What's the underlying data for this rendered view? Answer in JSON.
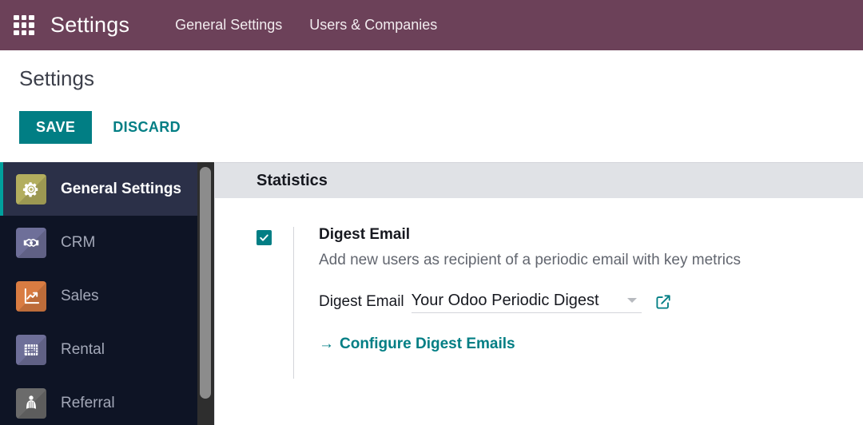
{
  "navbar": {
    "apps_icon": "grid-apps-icon",
    "brand": "Settings",
    "items": [
      {
        "label": "General Settings"
      },
      {
        "label": "Users & Companies"
      }
    ],
    "background_color": "#6c4159"
  },
  "control_panel": {
    "page_title": "Settings",
    "save_label": "SAVE",
    "discard_label": "DISCARD",
    "accent_color": "#017e84"
  },
  "sidebar": {
    "items": [
      {
        "label": "General Settings",
        "icon": "gear-icon",
        "icon_bg": "#b3ae5e",
        "active": true
      },
      {
        "label": "CRM",
        "icon": "handshake-icon",
        "icon_bg": "#6e6f99",
        "active": false
      },
      {
        "label": "Sales",
        "icon": "chart-arrow-icon",
        "icon_bg": "#d97c42",
        "active": false
      },
      {
        "label": "Rental",
        "icon": "calendar-grid-icon",
        "icon_bg": "#6e6f99",
        "active": false
      },
      {
        "label": "Referral",
        "icon": "person-cape-icon",
        "icon_bg": "#6b6b6b",
        "active": false
      }
    ],
    "background_color": "#0e1425",
    "active_background_color": "#2b3048",
    "active_accent_color": "#00a09d"
  },
  "main": {
    "section_title": "Statistics",
    "setting": {
      "checked": true,
      "name": "Digest Email",
      "description": "Add new users as recipient of a periodic email with key metrics",
      "field_label": "Digest Email",
      "field_value": "Your Odoo Periodic Digest",
      "external_link_icon": "external-link-icon",
      "configure_link": "Configure Digest Emails",
      "configure_arrow": "→"
    }
  }
}
